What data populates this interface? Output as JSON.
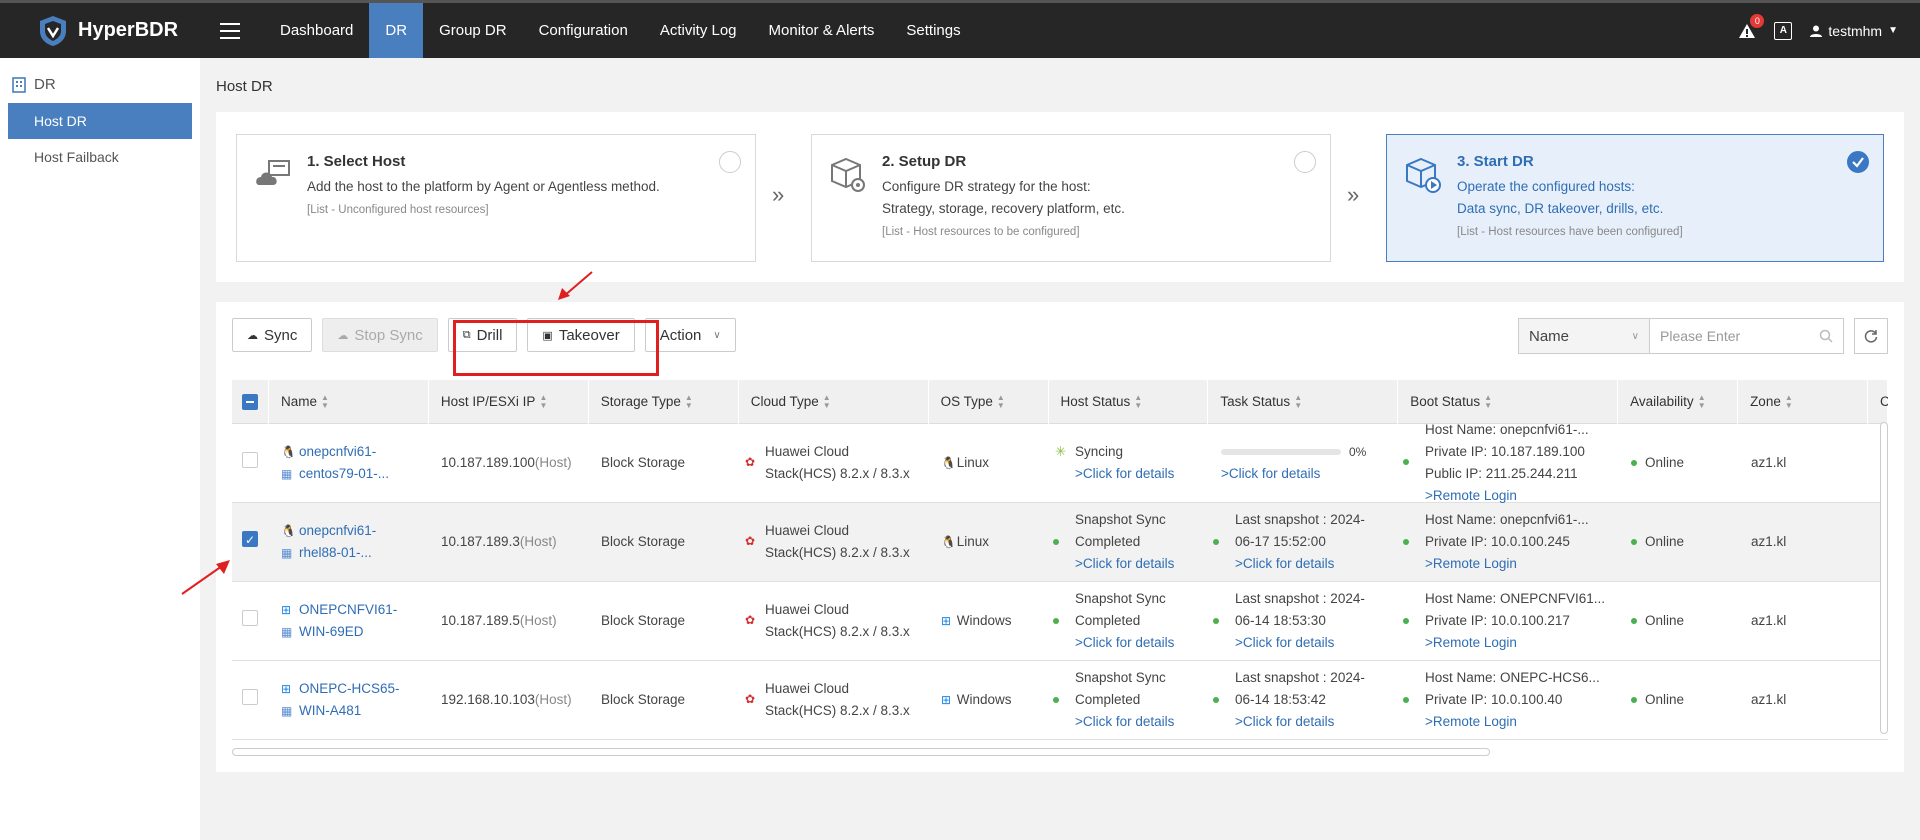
{
  "brand": {
    "name": "HyperBDR"
  },
  "nav": {
    "items": [
      "Dashboard",
      "DR",
      "Group DR",
      "Configuration",
      "Activity Log",
      "Monitor & Alerts",
      "Settings"
    ],
    "active": "DR"
  },
  "top_right": {
    "alert_count": "0",
    "lang": "A",
    "user": "testmhm"
  },
  "sidebar": {
    "section": "DR",
    "items": [
      {
        "label": "Host DR",
        "active": true
      },
      {
        "label": "Host Failback",
        "active": false
      }
    ]
  },
  "page_title": "Host DR",
  "steps": [
    {
      "title": "1. Select Host",
      "desc": [
        "Add the host to the platform by Agent or Agentless method."
      ],
      "note": "[List - Unconfigured host resources]",
      "checked": false
    },
    {
      "title": "2. Setup DR",
      "desc": [
        "Configure DR strategy for the host:",
        "Strategy, storage, recovery platform, etc."
      ],
      "note": "[List - Host resources to be configured]",
      "checked": false
    },
    {
      "title": "3. Start DR",
      "desc": [
        "Operate the configured hosts:",
        "Data sync, DR takeover, drills, etc."
      ],
      "note": "[List - Host resources have been configured]",
      "checked": true
    }
  ],
  "toolbar": {
    "sync": "Sync",
    "stop_sync": "Stop Sync",
    "drill": "Drill",
    "takeover": "Takeover",
    "action": "Action"
  },
  "search": {
    "field": "Name",
    "placeholder": "Please Enter"
  },
  "table": {
    "columns": [
      "Name",
      "Host IP/ESXi IP",
      "Storage Type",
      "Cloud Type",
      "OS Type",
      "Host Status",
      "Task Status",
      "Boot Status",
      "Availability",
      "Zone",
      "C"
    ],
    "rows": [
      {
        "checked": false,
        "os_icon": "linux",
        "name1": "onepcnfvi61-",
        "name2": "centos79-01-...",
        "ip": "10.187.189.100",
        "ip_tag": "(Host)",
        "storage": "Block Storage",
        "cloud1": "Huawei Cloud",
        "cloud2": "Stack(HCS) 8.2.x / 8.3.x",
        "os": "Linux",
        "host_status1": "Syncing",
        "host_status2": "",
        "host_link": ">Click for details",
        "task1": "",
        "task2": "",
        "task_progress": "0%",
        "task_link": ">Click for details",
        "boot1": "Host Name: onepcnfvi61-...",
        "boot2": "Private IP: 10.187.189.100",
        "boot3": "Public IP: 211.25.244.211",
        "boot_link": ">Remote Login",
        "availability": "Online",
        "zone": "az1.kl"
      },
      {
        "checked": true,
        "os_icon": "linux",
        "name1": "onepcnfvi61-",
        "name2": "rhel88-01-...",
        "ip": "10.187.189.3",
        "ip_tag": "(Host)",
        "storage": "Block Storage",
        "cloud1": "Huawei Cloud",
        "cloud2": "Stack(HCS) 8.2.x / 8.3.x",
        "os": "Linux",
        "host_status1": "Snapshot Sync",
        "host_status2": "Completed",
        "host_link": ">Click for details",
        "task1": "Last snapshot : 2024-",
        "task2": "06-17 15:52:00",
        "task_progress": "",
        "task_link": ">Click for details",
        "boot1": "Host Name: onepcnfvi61-...",
        "boot2": "Private IP: 10.0.100.245",
        "boot3": "",
        "boot_link": ">Remote Login",
        "availability": "Online",
        "zone": "az1.kl"
      },
      {
        "checked": false,
        "os_icon": "windows",
        "name1": "ONEPCNFVI61-",
        "name2": "WIN-69ED",
        "ip": "10.187.189.5",
        "ip_tag": "(Host)",
        "storage": "Block Storage",
        "cloud1": "Huawei Cloud",
        "cloud2": "Stack(HCS) 8.2.x / 8.3.x",
        "os": "Windows",
        "host_status1": "Snapshot Sync",
        "host_status2": "Completed",
        "host_link": ">Click for details",
        "task1": "Last snapshot : 2024-",
        "task2": "06-14 18:53:30",
        "task_progress": "",
        "task_link": ">Click for details",
        "boot1": "Host Name: ONEPCNFVI61...",
        "boot2": "Private IP: 10.0.100.217",
        "boot3": "",
        "boot_link": ">Remote Login",
        "availability": "Online",
        "zone": "az1.kl"
      },
      {
        "checked": false,
        "os_icon": "windows",
        "name1": "ONEPC-HCS65-",
        "name2": "WIN-A481",
        "ip": "192.168.10.103",
        "ip_tag": "(Host)",
        "storage": "Block Storage",
        "cloud1": "Huawei Cloud",
        "cloud2": "Stack(HCS) 8.2.x / 8.3.x",
        "os": "Windows",
        "host_status1": "Snapshot Sync",
        "host_status2": "Completed",
        "host_link": ">Click for details",
        "task1": "Last snapshot : 2024-",
        "task2": "06-14 18:53:42",
        "task_progress": "",
        "task_link": ">Click for details",
        "boot1": "Host Name: ONEPC-HCS6...",
        "boot2": "Private IP: 10.0.100.40",
        "boot3": "",
        "boot_link": ">Remote Login",
        "availability": "Online",
        "zone": "az1.kl"
      }
    ]
  },
  "colors": {
    "topbar": "#262626",
    "accent": "#4a7fbf",
    "link": "#2f6db5",
    "online": "#4caf50",
    "highlight": "#e02020"
  }
}
